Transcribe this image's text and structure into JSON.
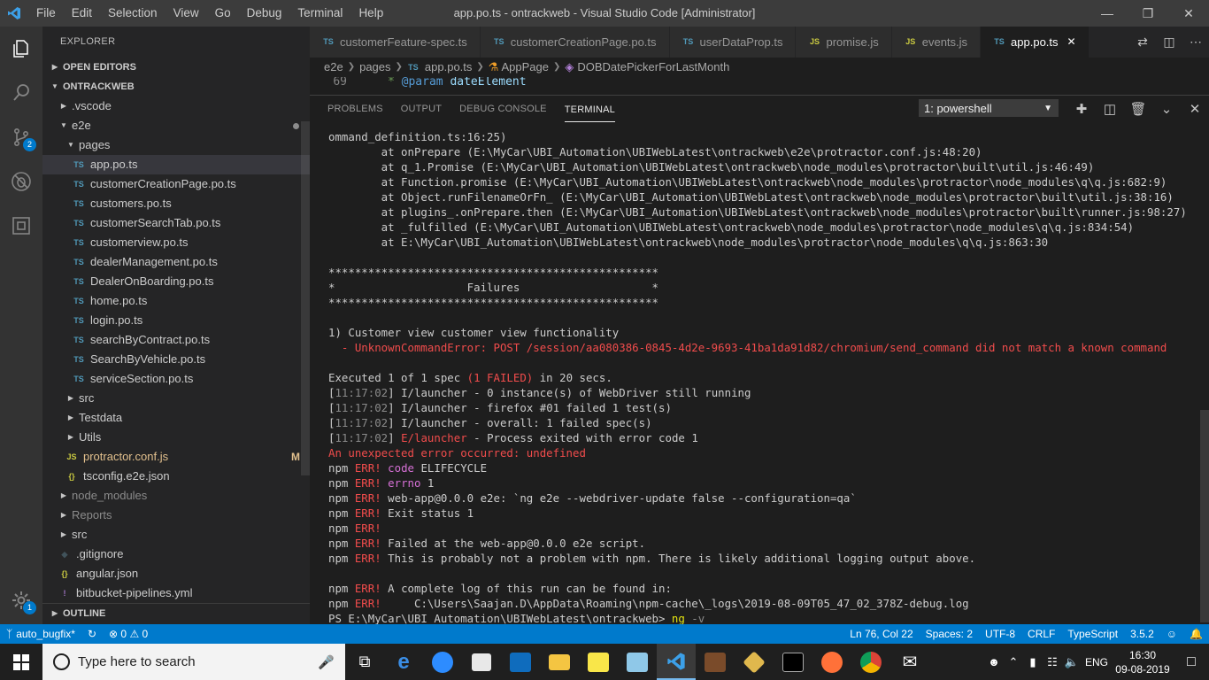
{
  "window": {
    "title": "app.po.ts - ontrackweb - Visual Studio Code [Administrator]",
    "menu": [
      "File",
      "Edit",
      "Selection",
      "View",
      "Go",
      "Debug",
      "Terminal",
      "Help"
    ]
  },
  "activity": {
    "scm_badge": "2",
    "settings_badge": "1"
  },
  "sidebar": {
    "title": "EXPLORER",
    "open_editors": "OPEN EDITORS",
    "project": "ONTRACKWEB",
    "outline": "OUTLINE",
    "tree": [
      {
        "label": ".vscode"
      },
      {
        "label": "e2e"
      },
      {
        "label": "pages"
      },
      {
        "label": "app.po.ts",
        "icon": "TS"
      },
      {
        "label": "customerCreationPage.po.ts",
        "icon": "TS"
      },
      {
        "label": "customers.po.ts",
        "icon": "TS"
      },
      {
        "label": "customerSearchTab.po.ts",
        "icon": "TS"
      },
      {
        "label": "customerview.po.ts",
        "icon": "TS"
      },
      {
        "label": "dealerManagement.po.ts",
        "icon": "TS"
      },
      {
        "label": "DealerOnBoarding.po.ts",
        "icon": "TS"
      },
      {
        "label": "home.po.ts",
        "icon": "TS"
      },
      {
        "label": "login.po.ts",
        "icon": "TS"
      },
      {
        "label": "searchByContract.po.ts",
        "icon": "TS"
      },
      {
        "label": "SearchByVehicle.po.ts",
        "icon": "TS"
      },
      {
        "label": "serviceSection.po.ts",
        "icon": "TS"
      },
      {
        "label": "src"
      },
      {
        "label": "Testdata"
      },
      {
        "label": "Utils"
      },
      {
        "label": "protractor.conf.js",
        "icon": "JS",
        "badge": "M"
      },
      {
        "label": "tsconfig.e2e.json",
        "icon": "{}"
      },
      {
        "label": "node_modules"
      },
      {
        "label": "Reports"
      },
      {
        "label": "src"
      },
      {
        "label": ".gitignore"
      },
      {
        "label": "angular.json",
        "icon": "{}"
      },
      {
        "label": "bitbucket-pipelines.yml",
        "icon": "!"
      }
    ]
  },
  "tabs": [
    {
      "label": "customerFeature-spec.ts",
      "icon": "TS"
    },
    {
      "label": "customerCreationPage.po.ts",
      "icon": "TS"
    },
    {
      "label": "userDataProp.ts",
      "icon": "TS"
    },
    {
      "label": "promise.js",
      "icon": "JS"
    },
    {
      "label": "events.js",
      "icon": "JS"
    },
    {
      "label": "app.po.ts",
      "icon": "TS"
    }
  ],
  "breadcrumb": [
    "e2e",
    "pages",
    "app.po.ts",
    "AppPage",
    "DOBDatePickerForLastMonth"
  ],
  "code_peek": {
    "line": "69",
    "star": "*",
    "tag": "@param",
    "name": "dateElement"
  },
  "panel": {
    "tabs": [
      "PROBLEMS",
      "OUTPUT",
      "DEBUG CONSOLE",
      "TERMINAL"
    ],
    "terminal_select": "1: powershell"
  },
  "terminal": {
    "stack": [
      "ommand_definition.ts:16:25)",
      "        at onPrepare (E:\\MyCar\\UBI_Automation\\UBIWebLatest\\ontrackweb\\e2e\\protractor.conf.js:48:20)",
      "        at q_1.Promise (E:\\MyCar\\UBI_Automation\\UBIWebLatest\\ontrackweb\\node_modules\\protractor\\built\\util.js:46:49)",
      "        at Function.promise (E:\\MyCar\\UBI_Automation\\UBIWebLatest\\ontrackweb\\node_modules\\protractor\\node_modules\\q\\q.js:682:9)",
      "        at Object.runFilenameOrFn_ (E:\\MyCar\\UBI_Automation\\UBIWebLatest\\ontrackweb\\node_modules\\protractor\\built\\util.js:38:16)",
      "        at plugins_.onPrepare.then (E:\\MyCar\\UBI_Automation\\UBIWebLatest\\ontrackweb\\node_modules\\protractor\\built\\runner.js:98:27)",
      "        at _fulfilled (E:\\MyCar\\UBI_Automation\\UBIWebLatest\\ontrackweb\\node_modules\\protractor\\node_modules\\q\\q.js:834:54)",
      "        at E:\\MyCar\\UBI_Automation\\UBIWebLatest\\ontrackweb\\node_modules\\protractor\\node_modules\\q\\q.js:863:30"
    ],
    "stars": "**************************************************",
    "failures_line": "*                    Failures                    *",
    "failure_title": "1) Customer view customer view functionality",
    "failure_error": "  - UnknownCommandError: POST /session/aa080386-0845-4d2e-9693-41ba1da91d82/chromium/send_command did not match a known command",
    "executed_a": "Executed 1 of 1 spec ",
    "executed_b": "(1 FAILED)",
    "executed_c": " in 20 secs.",
    "launcher": [
      {
        "time": "11:17:02",
        "tag": "I/launcher",
        "text": " - 0 instance(s) of WebDriver still running"
      },
      {
        "time": "11:17:02",
        "tag": "I/launcher",
        "text": " - firefox #01 failed 1 test(s)"
      },
      {
        "time": "11:17:02",
        "tag": "I/launcher",
        "text": " - overall: 1 failed spec(s)"
      },
      {
        "time": "11:17:02",
        "tag": "E/launcher",
        "text": " - Process exited with error code 1"
      }
    ],
    "unexpected": "An unexpected error occurred: undefined",
    "npm": [
      {
        "key": "code",
        "text": " ELIFECYCLE"
      },
      {
        "key": "errno",
        "text": " 1"
      },
      {
        "key": "",
        "text": " web-app@0.0.0 e2e: `ng e2e --webdriver-update false --configuration=qa`"
      },
      {
        "key": "",
        "text": " Exit status 1"
      },
      {
        "key": "",
        "text": ""
      },
      {
        "key": "",
        "text": " Failed at the web-app@0.0.0 e2e script."
      },
      {
        "key": "",
        "text": " This is probably not a problem with npm. There is likely additional logging output above."
      }
    ],
    "npm_log": [
      {
        "key": "",
        "text": " A complete log of this run can be found in:"
      },
      {
        "key": "",
        "text": "     C:\\Users\\Saajan.D\\AppData\\Roaming\\npm-cache\\_logs\\2019-08-09T05_47_02_378Z-debug.log"
      }
    ],
    "npm_prefix": "npm ",
    "npm_err": "ERR!",
    "prompt": "PS E:\\MyCar\\UBI_Automation\\UBIWebLatest\\ontrackweb> ",
    "cmd": "ng",
    "cmd_arg": " -v"
  },
  "statusbar": {
    "branch": "auto_bugfix*",
    "errors": "0",
    "warnings": "0",
    "position": "Ln 76, Col 22",
    "spaces": "Spaces: 2",
    "encoding": "UTF-8",
    "eol": "CRLF",
    "language": "TypeScript",
    "version": "3.5.2"
  },
  "taskbar": {
    "search_placeholder": "Type here to search",
    "lang": "ENG",
    "time": "16:30",
    "date": "09-08-2019"
  },
  "colors": {
    "accent": "#007acc",
    "ts": "#519aba",
    "js": "#cbcb41",
    "error": "#f14c4c"
  }
}
